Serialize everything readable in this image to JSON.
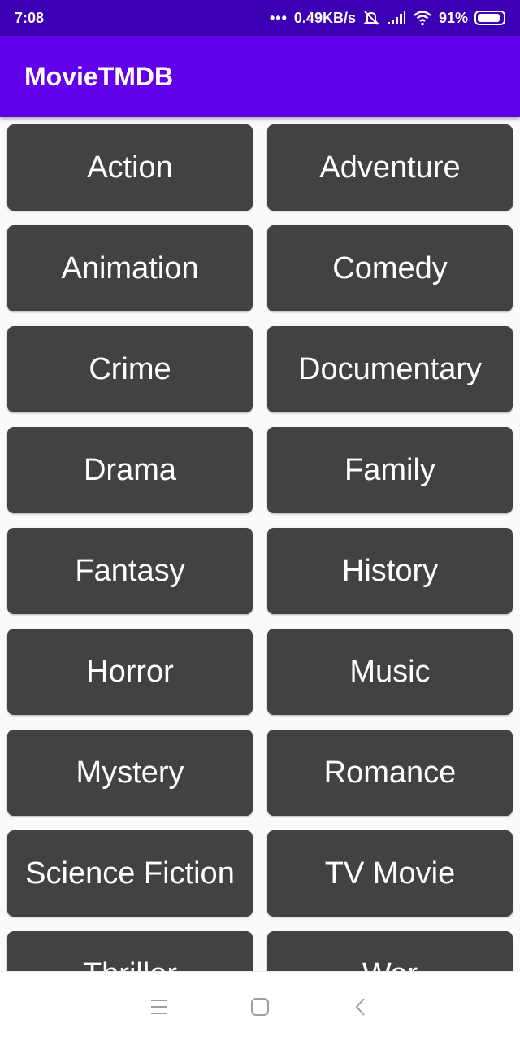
{
  "status_bar": {
    "time": "7:08",
    "more_dots": "•••",
    "network_speed": "0.49KB/s",
    "battery_percent": "91%",
    "battery_level": 0.91,
    "icons": [
      "mute-icon",
      "signal-icon",
      "wifi-icon",
      "battery-icon"
    ]
  },
  "app_bar": {
    "title": "MovieTMDB",
    "color": "#6200ea"
  },
  "genres": [
    "Action",
    "Adventure",
    "Animation",
    "Comedy",
    "Crime",
    "Documentary",
    "Drama",
    "Family",
    "Fantasy",
    "History",
    "Horror",
    "Music",
    "Mystery",
    "Romance",
    "Science Fiction",
    "TV Movie",
    "Thriller",
    "War"
  ],
  "colors": {
    "status_bar": "#3b00b3",
    "button": "#424242",
    "background": "#fafafa"
  },
  "nav_bar": {
    "icons": [
      "menu-icon",
      "home-icon",
      "back-icon"
    ]
  }
}
